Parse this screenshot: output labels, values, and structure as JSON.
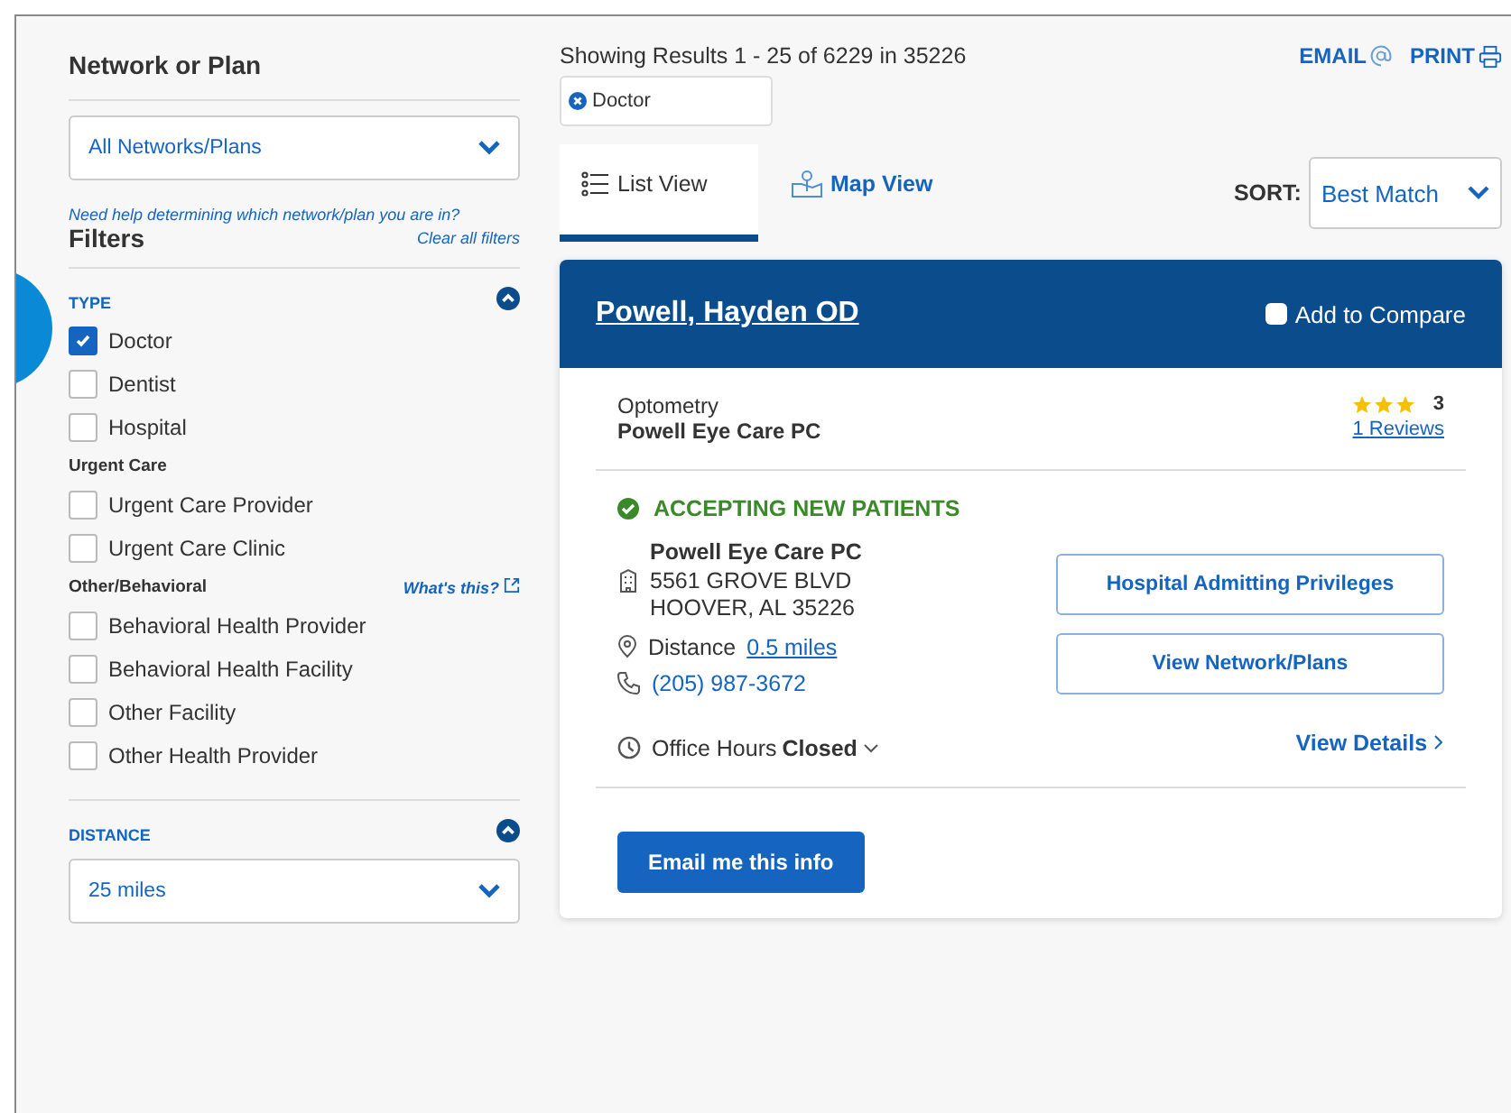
{
  "network": {
    "title": "Network or Plan",
    "select": "All Networks/Plans",
    "help": "Need help determining which network/plan you are in?"
  },
  "filters": {
    "title": "Filters",
    "clear": "Clear all filters",
    "sections": [
      {
        "title": "TYPE",
        "expanded": true,
        "groups": [
          {
            "items": [
              {
                "label": "Doctor",
                "checked": true
              },
              {
                "label": "Dentist",
                "checked": false
              },
              {
                "label": "Hospital",
                "checked": false
              }
            ]
          },
          {
            "title": "Urgent Care",
            "items": [
              {
                "label": "Urgent Care Provider",
                "checked": false
              },
              {
                "label": "Urgent Care Clinic",
                "checked": false
              }
            ]
          },
          {
            "title": "Other/Behavioral",
            "link": "What's this?",
            "items": [
              {
                "label": "Behavioral Health Provider",
                "checked": false
              },
              {
                "label": "Behavioral Health Facility",
                "checked": false
              },
              {
                "label": "Other Facility",
                "checked": false
              },
              {
                "label": "Other Health Provider",
                "checked": false
              }
            ]
          }
        ]
      },
      {
        "title": "DISTANCE",
        "expanded": true,
        "select": "25 miles"
      }
    ]
  },
  "results": {
    "summary": "Showing Results 1 - 25 of 6229 in 35226",
    "email": "EMAIL",
    "print": "PRINT",
    "chips": [
      "Doctor"
    ]
  },
  "tabs": [
    {
      "label": "List View",
      "selected": true,
      "kind": "list"
    },
    {
      "label": "Map View",
      "selected": false,
      "kind": "map"
    }
  ],
  "sort": {
    "label": "SORT:",
    "value": "Best Match"
  },
  "card": {
    "name": "Powell, Hayden OD",
    "compare": {
      "label": "Add to Compare",
      "checked": false
    },
    "specialty": "Optometry",
    "practice": "Powell Eye Care PC",
    "stars": 3,
    "rating": "3",
    "reviews": "1 Reviews",
    "status": "ACCEPTING NEW PATIENTS",
    "address": [
      "Powell Eye Care PC",
      "5561 GROVE BLVD",
      "HOOVER, AL 35226"
    ],
    "distance_label": "Distance",
    "distance": "0.5 miles",
    "phone": "(205) 987-3672",
    "hours_label": "Office Hours",
    "hours": "Closed",
    "buttons": [
      "Hospital Admitting Privileges",
      "View Network/Plans"
    ],
    "details": "View Details",
    "email_button": "Email me this info"
  }
}
